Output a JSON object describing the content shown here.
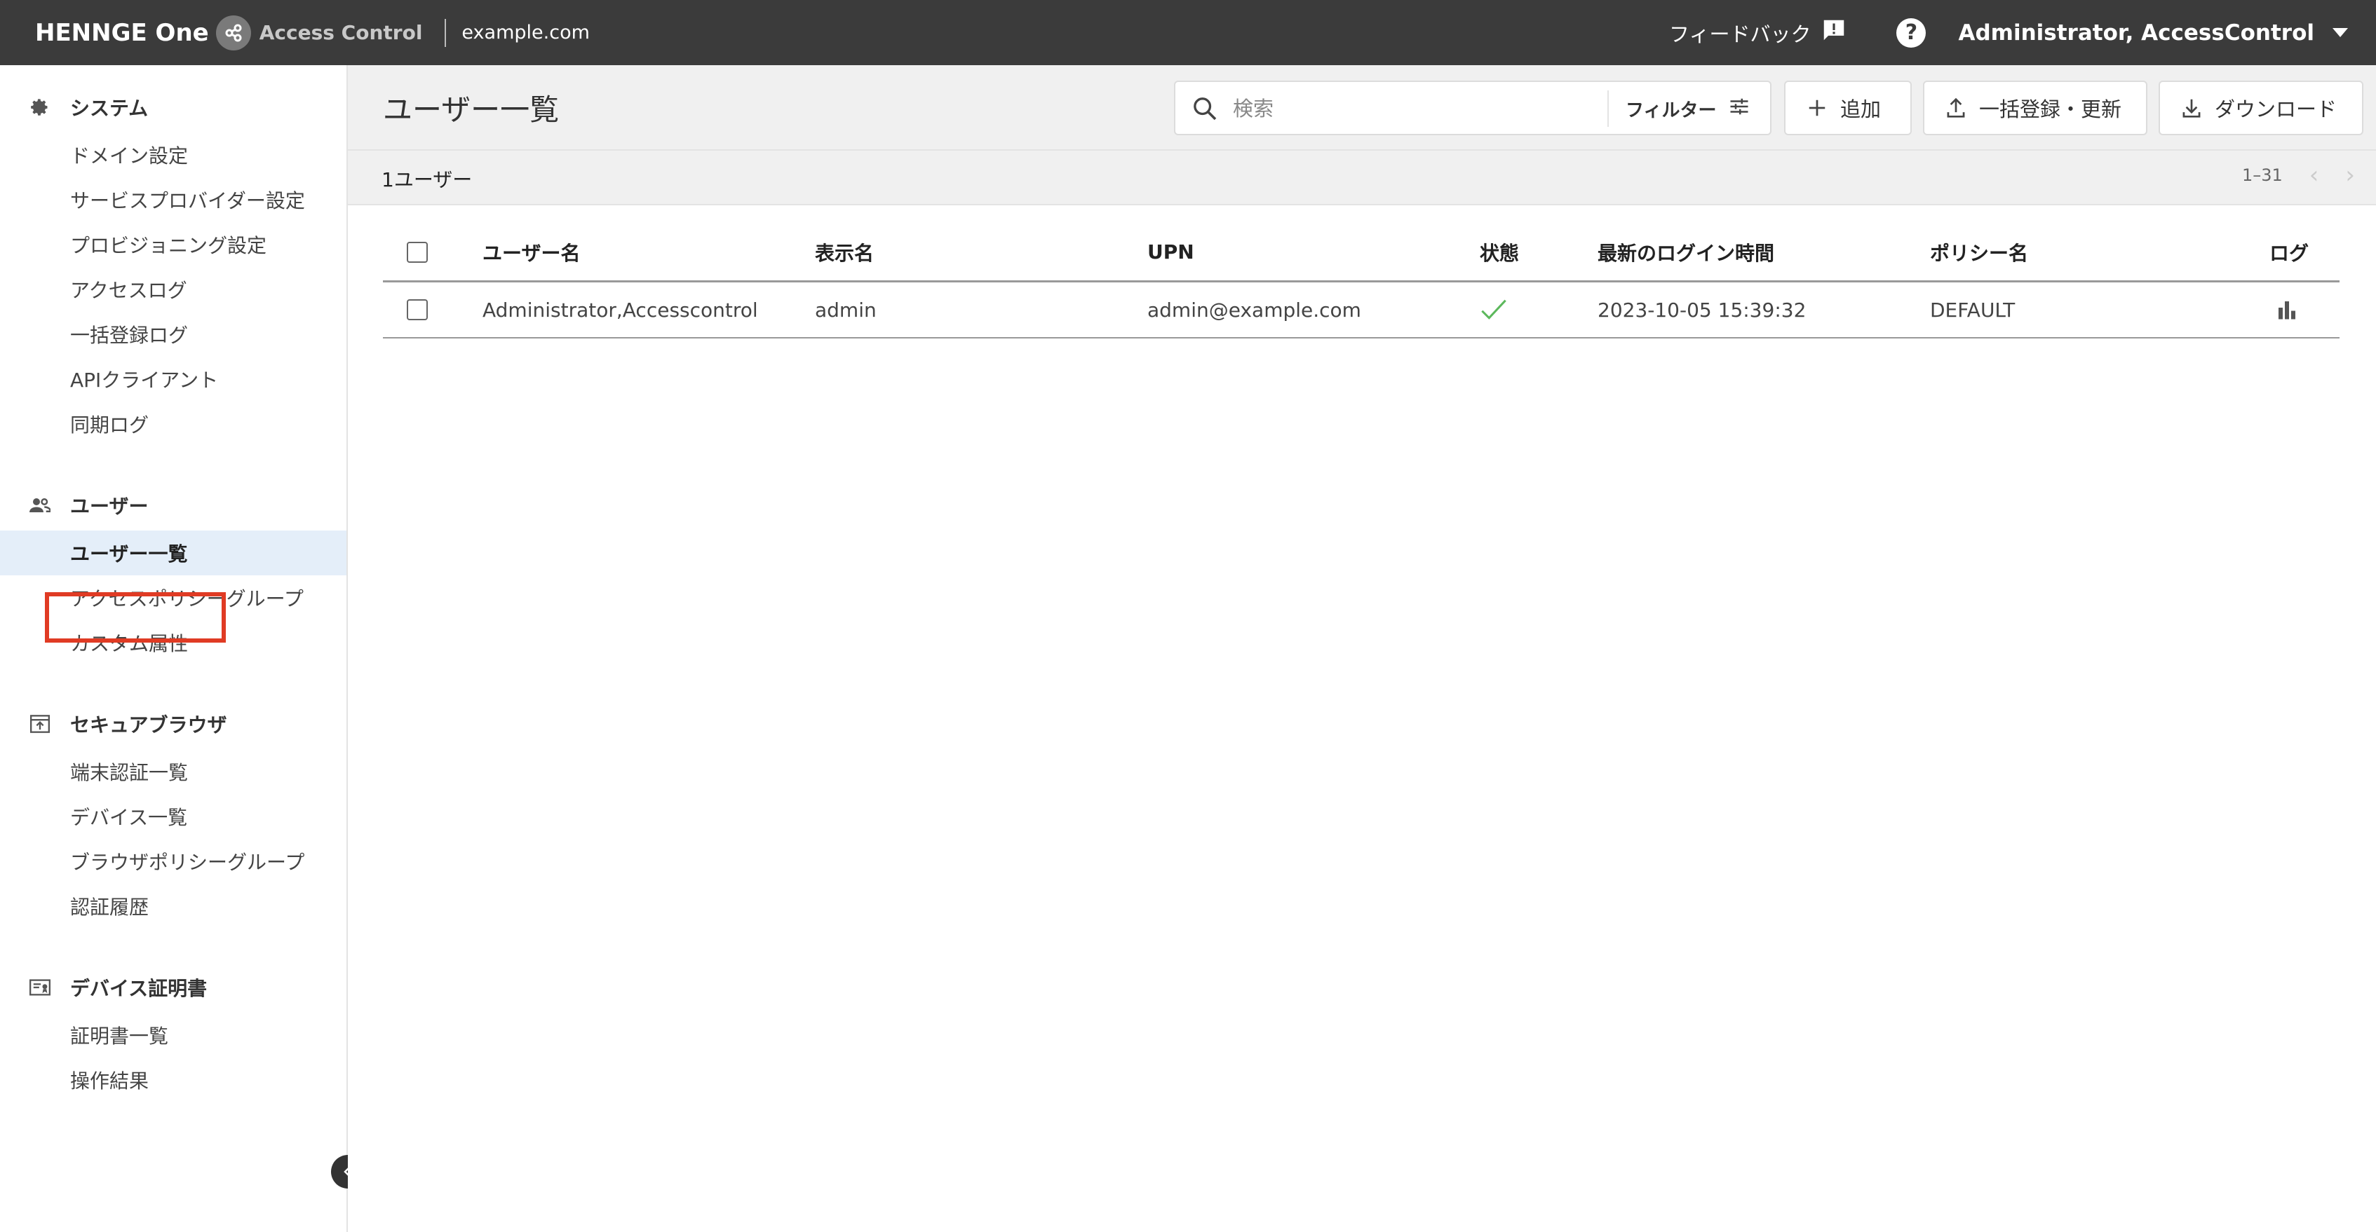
{
  "header": {
    "brand": "HENNGE One",
    "product": "Access Control",
    "domain": "example.com",
    "feedback_label": "フィードバック",
    "user_label": "Administrator, AccessControl"
  },
  "sidebar": {
    "sections": [
      {
        "title": "システム",
        "icon": "gear-icon",
        "items": [
          "ドメイン設定",
          "サービスプロバイダー設定",
          "プロビジョニング設定",
          "アクセスログ",
          "一括登録ログ",
          "APIクライアント",
          "同期ログ"
        ]
      },
      {
        "title": "ユーザー",
        "icon": "users-icon",
        "items": [
          "ユーザー一覧",
          "アクセスポリシーグループ",
          "カスタム属性"
        ]
      },
      {
        "title": "セキュアブラウザ",
        "icon": "browser-icon",
        "items": [
          "端末認証一覧",
          "デバイス一覧",
          "ブラウザポリシーグループ",
          "認証履歴"
        ]
      },
      {
        "title": "デバイス証明書",
        "icon": "certificate-icon",
        "items": [
          "証明書一覧",
          "操作結果"
        ]
      }
    ],
    "active_item": "ユーザー一覧"
  },
  "main": {
    "title": "ユーザー一覧",
    "search_placeholder": "検索",
    "filter_label": "フィルター",
    "add_label": "追加",
    "bulk_label": "一括登録・更新",
    "download_label": "ダウンロード",
    "count_text": "1ユーザー",
    "pagination": "1–31"
  },
  "table": {
    "columns": [
      "ユーザー名",
      "表示名",
      "UPN",
      "状態",
      "最新のログイン時間",
      "ポリシー名",
      "ログ"
    ],
    "rows": [
      {
        "username": "Administrator,Accesscontrol",
        "display_name": "admin",
        "upn": "admin@example.com",
        "status": "active",
        "last_login": "2023-10-05 15:39:32",
        "policy": "DEFAULT"
      }
    ]
  },
  "colors": {
    "topbar": "#3b3b3b",
    "active_bg": "#e4eef9",
    "highlight": "#e03b24",
    "status_ok": "#5cb85c"
  }
}
